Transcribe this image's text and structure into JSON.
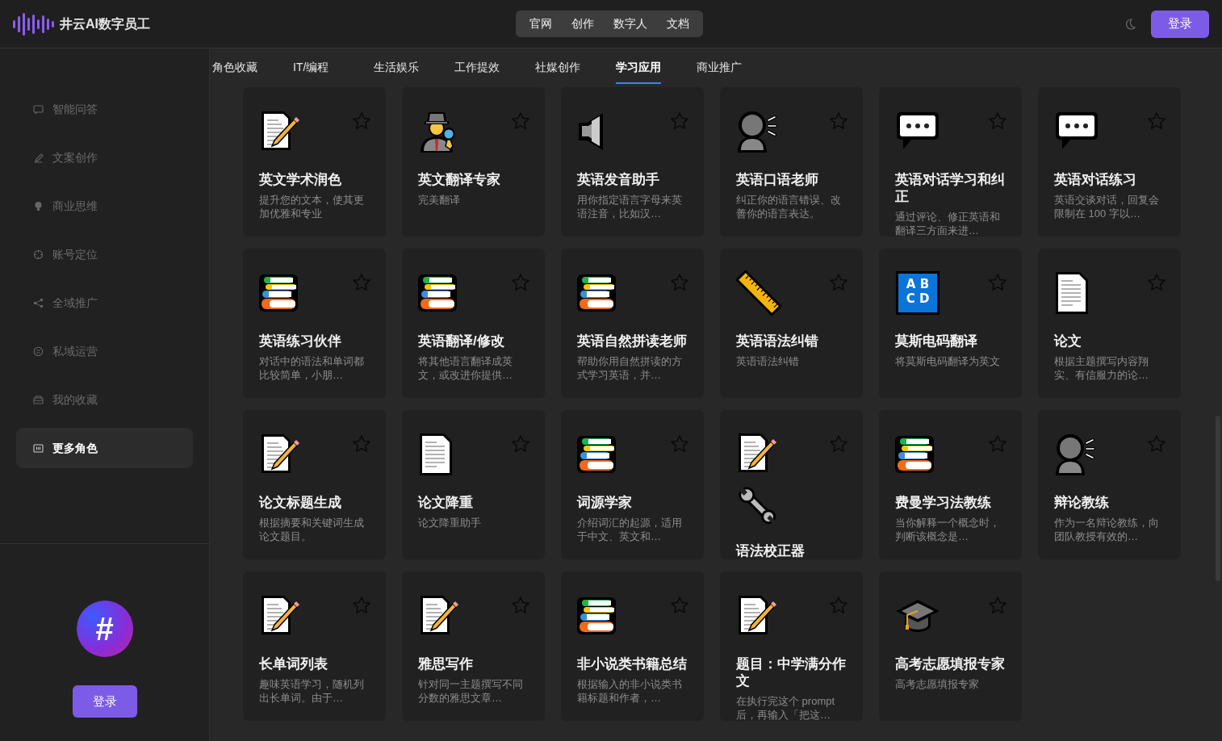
{
  "header": {
    "brand": "井云AI数字员工",
    "nav": [
      {
        "label": "官网"
      },
      {
        "label": "创作"
      },
      {
        "label": "数字人"
      },
      {
        "label": "文档"
      }
    ],
    "login": "登录"
  },
  "sidebar": {
    "items": [
      {
        "label": "智能问答",
        "kind": "chat",
        "selected": false
      },
      {
        "label": "文案创作",
        "kind": "pen",
        "selected": false
      },
      {
        "label": "商业思维",
        "kind": "bulb",
        "selected": false
      },
      {
        "label": "账号定位",
        "kind": "target",
        "selected": false
      },
      {
        "label": "全域推广",
        "kind": "share",
        "selected": false
      },
      {
        "label": "私域运营",
        "kind": "message",
        "selected": false
      },
      {
        "label": "我的收藏",
        "kind": "inbox",
        "selected": false
      },
      {
        "label": "更多角色",
        "kind": "card",
        "selected": true
      }
    ],
    "logo_symbol": "#",
    "login": "登录"
  },
  "tabs": [
    {
      "label": "角色收藏",
      "selected": false
    },
    {
      "label": "IT/编程",
      "selected": false
    },
    {
      "label": "生活娱乐",
      "selected": false
    },
    {
      "label": "工作提效",
      "selected": false
    },
    {
      "label": "社媒创作",
      "selected": false
    },
    {
      "label": "学习应用",
      "selected": true
    },
    {
      "label": "商业推广",
      "selected": false
    }
  ],
  "cards": [
    {
      "kind": "memo",
      "title": "英文学术润色",
      "description": "提升您的文本，使其更加优雅和专业",
      "favorite": false
    },
    {
      "kind": "detective",
      "title": "英文翻译专家",
      "description": "完美翻译",
      "favorite": false
    },
    {
      "kind": "speaker",
      "title": "英语发音助手",
      "description": "用你指定语言字母来英语注音，比如汉…",
      "favorite": false
    },
    {
      "kind": "speaking_head",
      "title": "英语口语老师",
      "description": "纠正你的语言错误、改善你的语言表达。",
      "favorite": false
    },
    {
      "kind": "bubble",
      "title": "英语对话学习和纠正",
      "description": "通过评论、修正英语和翻译三方面来进…",
      "favorite": false
    },
    {
      "kind": "bubble",
      "title": "英语对话练习",
      "description": "英语交谈对话，回复会限制在 100 字以…",
      "favorite": false
    },
    {
      "kind": "books",
      "title": "英语练习伙伴",
      "description": "对话中的语法和单词都比较简单，小朋…",
      "favorite": false
    },
    {
      "kind": "books",
      "title": "英语翻译/修改",
      "description": "将其他语言翻译成英文，或改进你提供…",
      "favorite": false
    },
    {
      "kind": "books",
      "title": "英语自然拼读老师",
      "description": "帮助你用自然拼读的方式学习英语，并…",
      "favorite": false
    },
    {
      "kind": "ruler",
      "title": "英语语法纠错",
      "description": "英语语法纠错",
      "favorite": false
    },
    {
      "kind": "letters",
      "icon_lines": [
        "A B",
        "C D"
      ],
      "title": "莫斯电码翻译",
      "description": "将莫斯电码翻译为英文",
      "favorite": false
    },
    {
      "kind": "document",
      "title": "论文",
      "description": "根据主题撰写内容翔实、有信服力的论…",
      "favorite": false
    },
    {
      "kind": "memo",
      "title": "论文标题生成",
      "description": "根据摘要和关键词生成论文题目。",
      "favorite": false
    },
    {
      "kind": "document",
      "title": "论文降重",
      "description": "论文降重助手",
      "favorite": false
    },
    {
      "kind": "books",
      "title": "词源学家",
      "description": "介绍词汇的起源，适用于中文、英文和…",
      "favorite": false
    },
    {
      "kind": "memo_wrench",
      "title": "语法校正器",
      "favorite": false
    },
    {
      "kind": "books",
      "title": "费曼学习法教练",
      "description": "当你解释一个概念时，判断该概念是…",
      "favorite": false
    },
    {
      "kind": "speaking_head",
      "title": "辩论教练",
      "description": "作为一名辩论教练，向团队教授有效的…",
      "favorite": false
    },
    {
      "kind": "memo",
      "title": "长单词列表",
      "description": "趣味英语学习，随机列出长单词。由于…",
      "favorite": false
    },
    {
      "kind": "memo",
      "title": "雅思写作",
      "description": "针对同一主题撰写不同分数的雅思文章…",
      "favorite": false
    },
    {
      "kind": "books",
      "title": "非小说类书籍总结",
      "description": "根据输入的非小说类书籍标题和作者，…",
      "favorite": false
    },
    {
      "kind": "memo",
      "title": "题目：中学满分作文",
      "description": "在执行完这个 prompt 后，再输入「把这…",
      "favorite": false
    },
    {
      "kind": "cap",
      "title": "高考志愿填报专家",
      "description": "高考志愿填报专家",
      "favorite": false
    }
  ]
}
